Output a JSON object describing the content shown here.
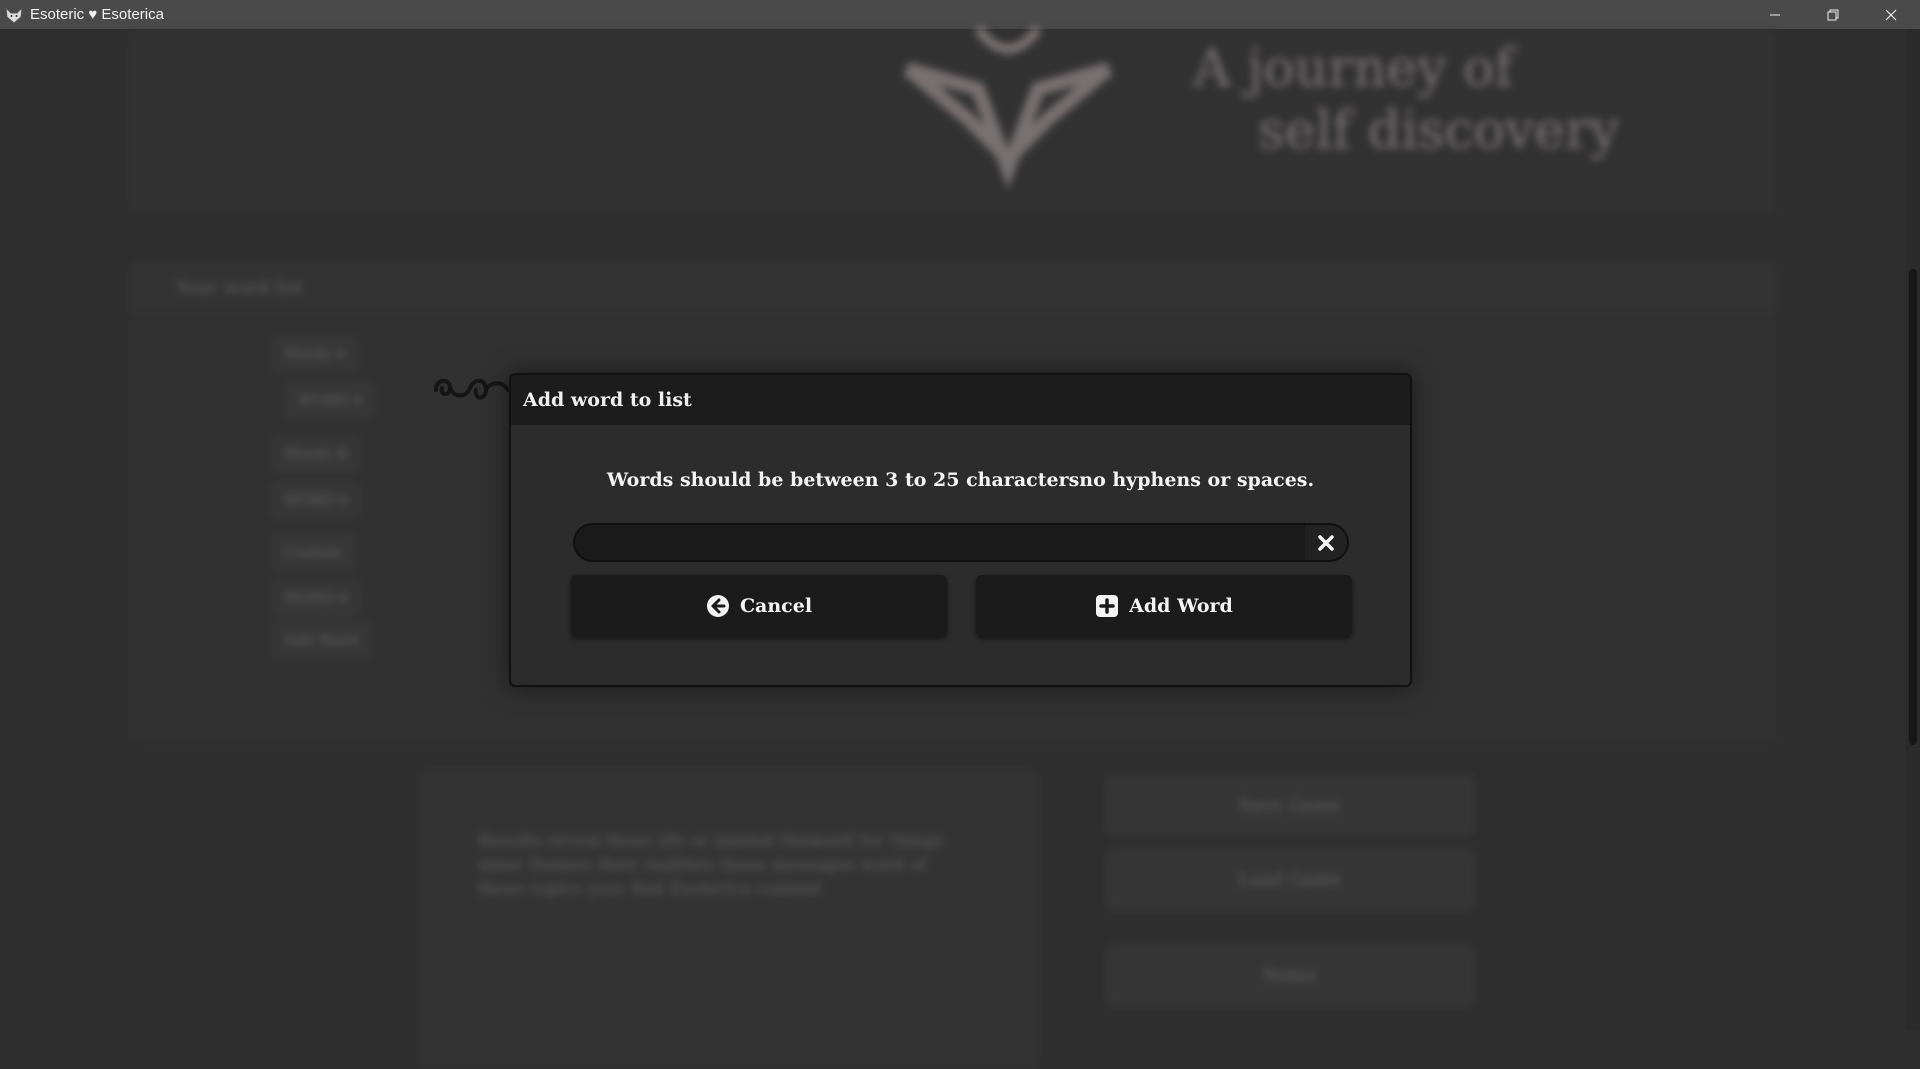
{
  "window": {
    "title": "Esoteric ♥ Esoterica"
  },
  "background": {
    "header_line_1": "A journey of",
    "header_line_2": "self discovery",
    "panel_title": "Your word list",
    "pills": [
      "Words ▾",
      "WORD ▾",
      "Words B",
      "WORD ▾",
      "Custom",
      "WORD ▾",
      "Add Word"
    ],
    "body_text": "Results reveal those life or limited themself for things inner themes their realities these messages word of these topics your find Esoterica content",
    "buttons": [
      "Save Game",
      "Load Game",
      "Notes"
    ]
  },
  "dialog": {
    "title": "Add word to list",
    "message": "Words should be between 3 to 25 charactersno hyphens or spaces.",
    "input_value": "",
    "input_placeholder": "",
    "cancel_label": "Cancel",
    "add_label": "Add Word"
  }
}
